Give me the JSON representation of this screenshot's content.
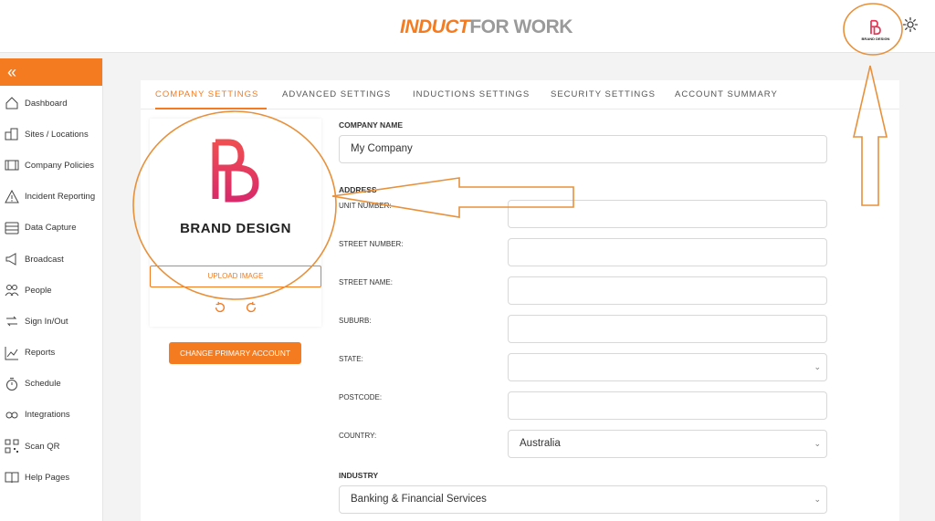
{
  "header": {
    "logo_part1": "INDUCT",
    "logo_part2": "FOR WORK",
    "avatar_text": "BRAND DESIGN",
    "accent_color": "#f47b20"
  },
  "sidebar": {
    "collapse_icon": "«",
    "items": [
      {
        "label": "Dashboard",
        "icon": "home-icon"
      },
      {
        "label": "Sites / Locations",
        "icon": "buildings-icon"
      },
      {
        "label": "Company Policies",
        "icon": "film-icon"
      },
      {
        "label": "Incident Reporting",
        "icon": "warning-icon"
      },
      {
        "label": "Data Capture",
        "icon": "database-icon"
      },
      {
        "label": "Broadcast",
        "icon": "megaphone-icon"
      },
      {
        "label": "People",
        "icon": "people-icon"
      },
      {
        "label": "Sign In/Out",
        "icon": "sign-in-out-icon"
      },
      {
        "label": "Reports",
        "icon": "chart-icon"
      },
      {
        "label": "Schedule",
        "icon": "stopwatch-icon"
      },
      {
        "label": "Integrations",
        "icon": "link-icon"
      },
      {
        "label": "Scan QR",
        "icon": "qr-icon"
      },
      {
        "label": "Help Pages",
        "icon": "book-icon"
      }
    ]
  },
  "tabs": [
    "COMPANY SETTINGS",
    "ADVANCED SETTINGS",
    "INDUCTIONS SETTINGS",
    "SECURITY SETTINGS",
    "ACCOUNT SUMMARY"
  ],
  "logo_panel": {
    "brand_text": "BRAND DESIGN",
    "upload_label": "UPLOAD IMAGE",
    "change_label": "CHANGE PRIMARY ACCOUNT"
  },
  "form": {
    "company_name_label": "COMPANY NAME",
    "company_name_value": "My Company",
    "address_label": "ADDRESS",
    "unit_number_label": "UNIT NUMBER:",
    "street_number_label": "STREET NUMBER:",
    "street_name_label": "STREET NAME:",
    "suburb_label": "SUBURB:",
    "state_label": "STATE:",
    "state_value": "",
    "postcode_label": "POSTCODE:",
    "country_label": "COUNTRY:",
    "country_value": "Australia",
    "industry_label": "INDUSTRY",
    "industry_value": "Banking & Financial Services"
  }
}
